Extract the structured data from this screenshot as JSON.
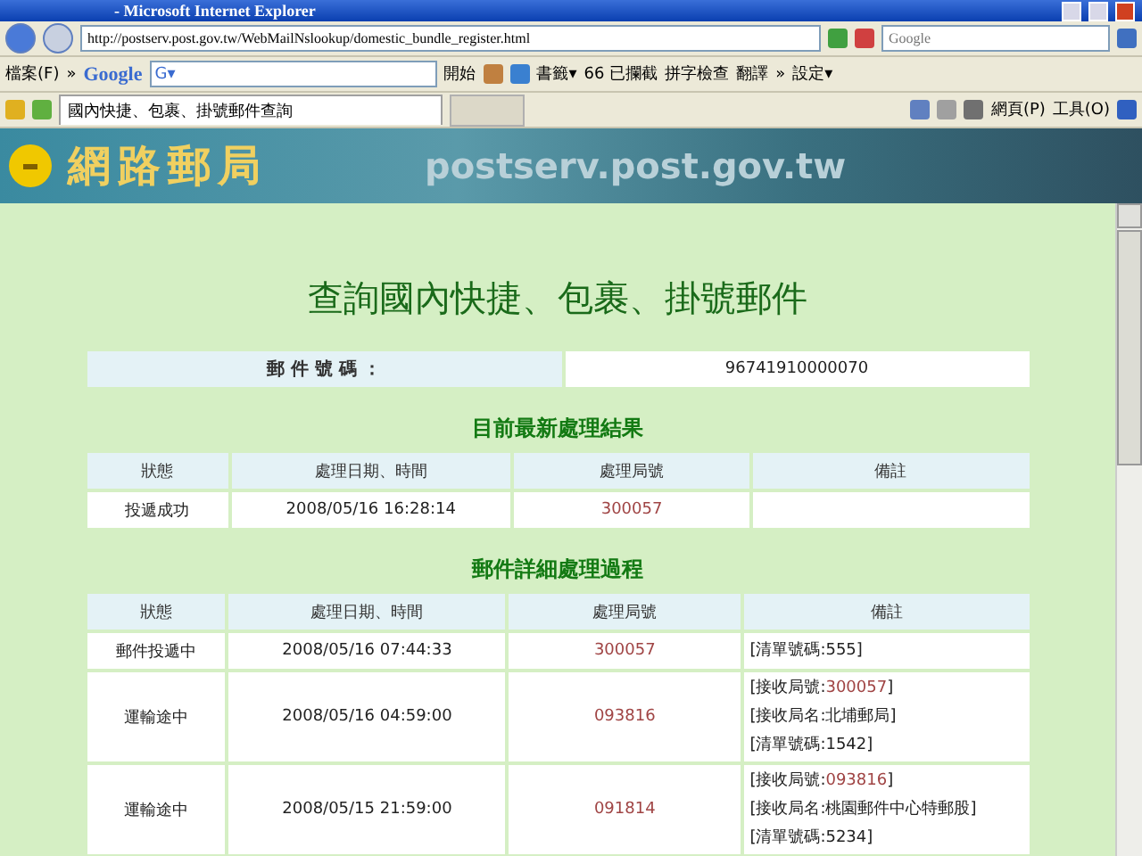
{
  "window": {
    "title": "- Microsoft Internet Explorer"
  },
  "address_bar": {
    "url": "http://postserv.post.gov.tw/WebMailNslookup/domestic_bundle_register.html",
    "search_placeholder": "Google"
  },
  "toolbar": {
    "menu": "檔案(F)",
    "more": "»",
    "google_logo": "Google",
    "google_field": "G▾",
    "start": "開始",
    "bookmarks": "書籤▾",
    "blocked": "66 已攔截",
    "spellcheck": "拼字檢查",
    "translate": "翻譯",
    "more2": "»",
    "settings": "設定▾"
  },
  "tab_bar": {
    "tab": "國內快捷、包裹、掛號郵件查詢",
    "page_menu": "網頁(P)",
    "tools_menu": "工具(O)"
  },
  "banner": {
    "logo_text": "網路郵局",
    "site": "postserv.post.gov.tw"
  },
  "page": {
    "title": "查詢國內快捷、包裹、掛號郵件",
    "tracking": {
      "label": "郵 件 號 碼 ：",
      "value": "96741910000070"
    },
    "latest": {
      "title": "目前最新處理結果",
      "columns": [
        "狀態",
        "處理日期、時間",
        "處理局號",
        "備註"
      ],
      "rows": [
        {
          "status": "投遞成功",
          "datetime": "2008/05/16 16:28:14",
          "office": "300057",
          "remarks": []
        }
      ]
    },
    "details": {
      "title": "郵件詳細處理過程",
      "columns": [
        "狀態",
        "處理日期、時間",
        "處理局號",
        "備註"
      ],
      "rows": [
        {
          "status": "郵件投遞中",
          "datetime": "2008/05/16 07:44:33",
          "office": "300057",
          "remarks": [
            {
              "text": "[清單號碼:555]"
            }
          ]
        },
        {
          "status": "運輸途中",
          "datetime": "2008/05/16 04:59:00",
          "office": "093816",
          "remarks": [
            {
              "text": "[接收局號:",
              "link": "300057",
              "end": "]"
            },
            {
              "text": "[接收局名:北埔郵局]"
            },
            {
              "text": "[清單號碼:1542]"
            }
          ]
        },
        {
          "status": "運輸途中",
          "datetime": "2008/05/15 21:59:00",
          "office": "091814",
          "remarks": [
            {
              "text": "[接收局號:",
              "link": "093816",
              "end": "]"
            },
            {
              "text": "[接收局名:桃園郵件中心特郵股]"
            },
            {
              "text": "[清單號碼:5234]"
            }
          ]
        }
      ]
    }
  }
}
